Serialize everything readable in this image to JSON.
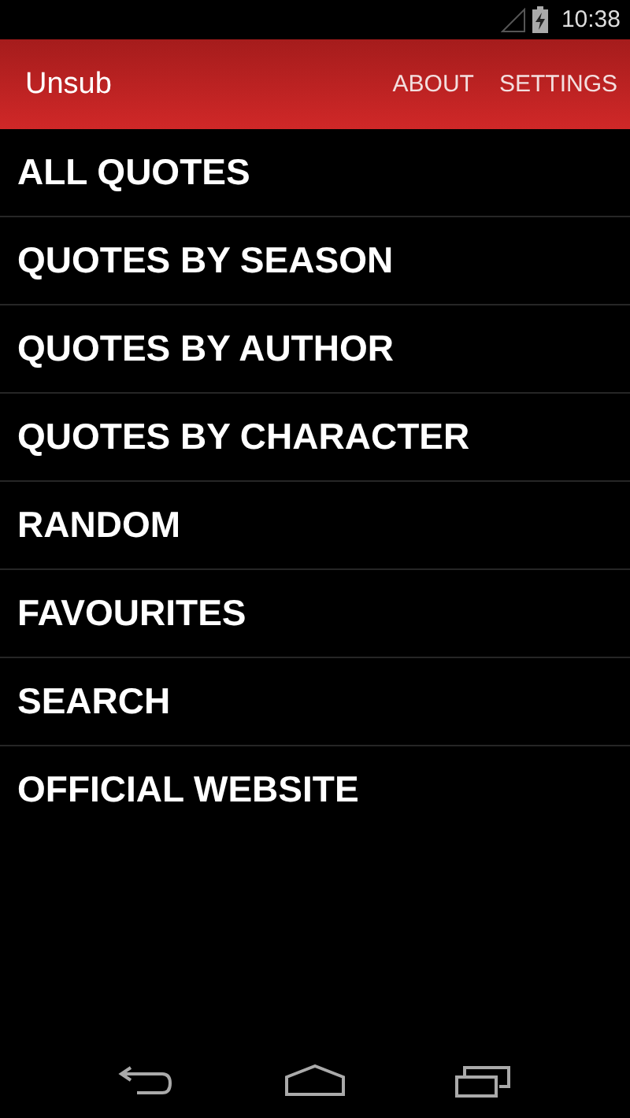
{
  "status_bar": {
    "time": "10:38"
  },
  "action_bar": {
    "title": "Unsub",
    "actions": [
      "ABOUT",
      "SETTINGS"
    ]
  },
  "menu": [
    "ALL QUOTES",
    "QUOTES BY SEASON",
    "QUOTES BY AUTHOR",
    "QUOTES BY CHARACTER",
    "RANDOM",
    "FAVOURITES",
    "SEARCH",
    "OFFICIAL WEBSITE"
  ]
}
